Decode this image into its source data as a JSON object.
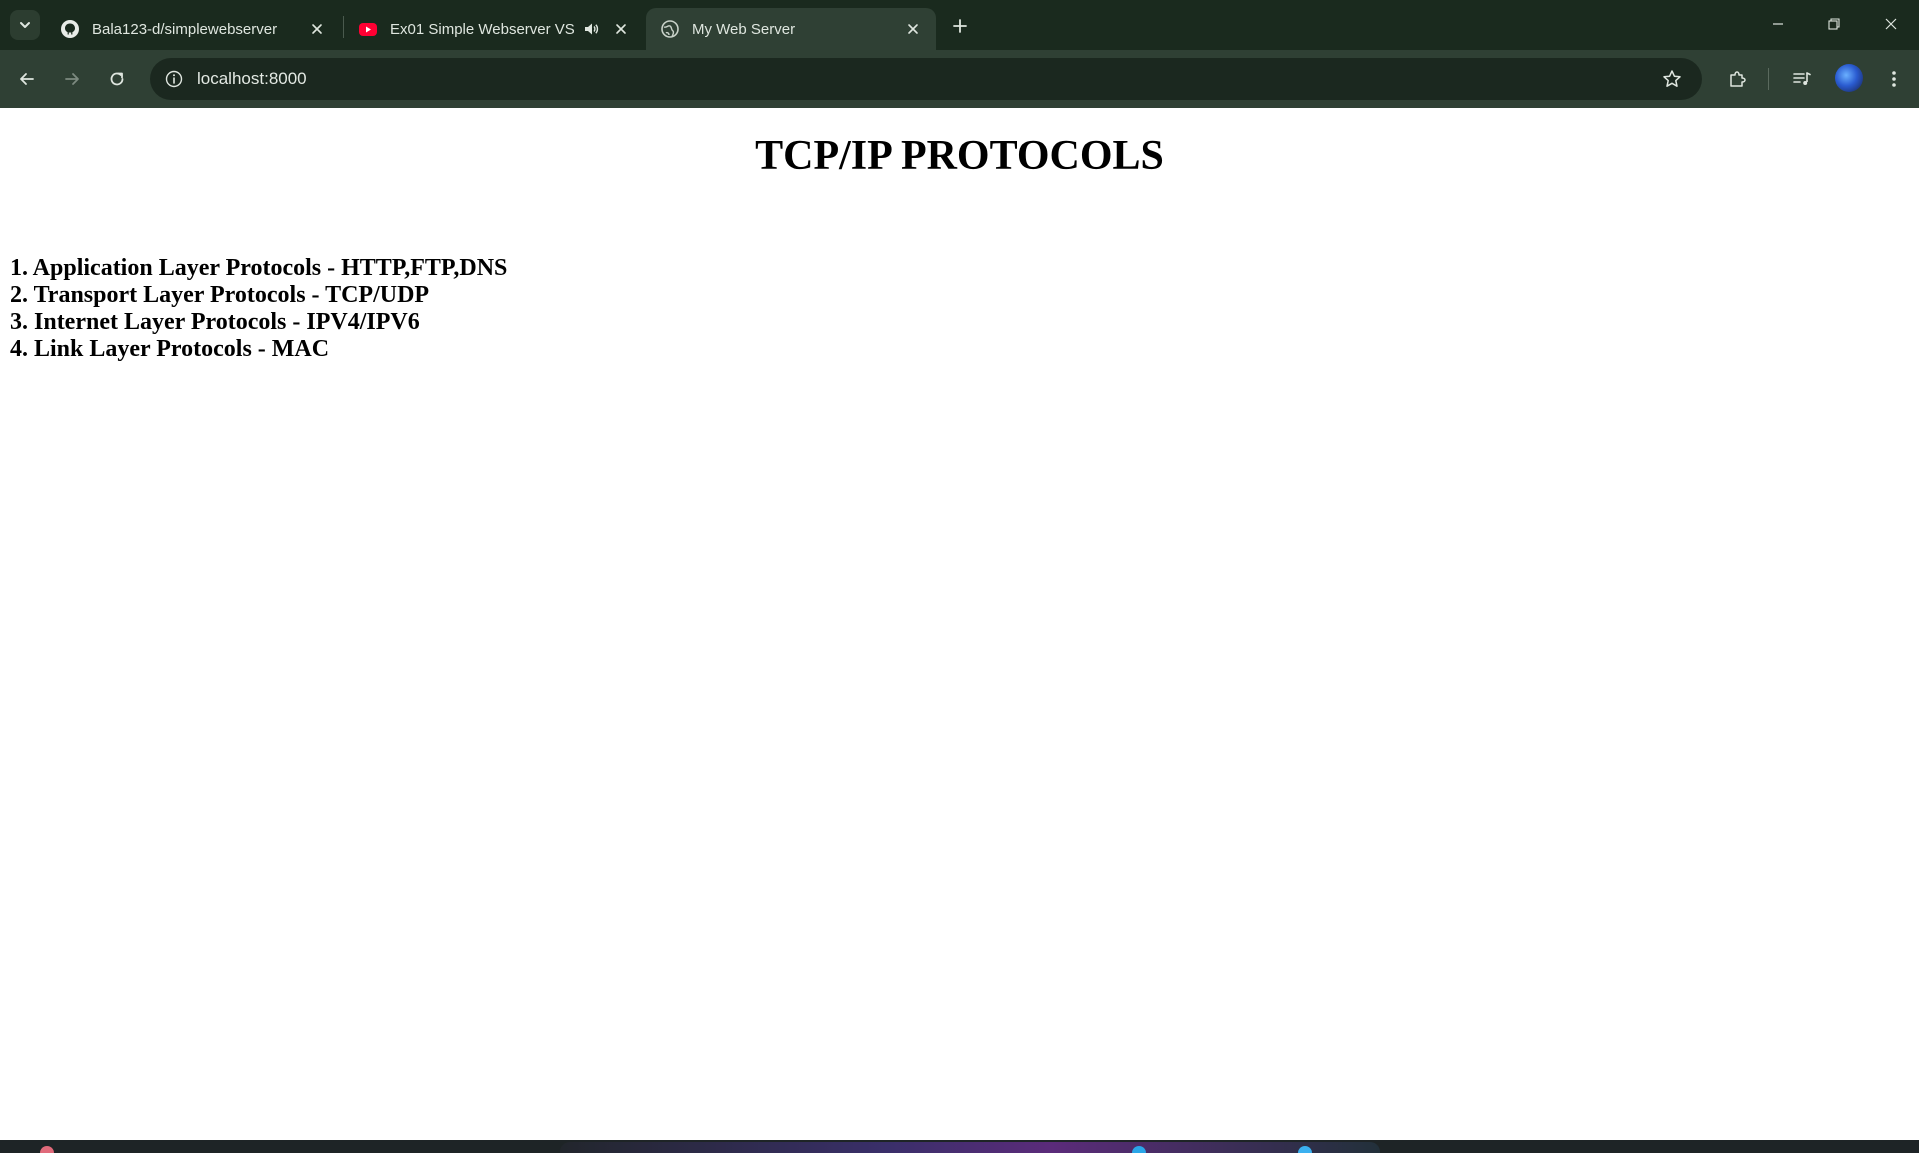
{
  "browser": {
    "tabs": [
      {
        "title": "Bala123-d/simplewebserver",
        "icon": "github-icon"
      },
      {
        "title": "Ex01 Simple Webserver VS (",
        "icon": "youtube-icon",
        "audio": true
      },
      {
        "title": "My Web Server",
        "icon": "globe-icon",
        "active": true
      }
    ],
    "address": {
      "url": "localhost:8000"
    }
  },
  "page": {
    "title": "TCP/IP PROTOCOLS",
    "protocols": [
      "1. Application Layer Protocols - HTTP,FTP,DNS",
      "2. Transport Layer Protocols - TCP/UDP",
      "3. Internet Layer Protocols - IPV4/IPV6",
      "4. Link Layer Protocols - MAC"
    ]
  },
  "colors": {
    "tabstrip": "#1a2a1e",
    "toolbar": "#2f4034",
    "omnibox": "#1b281f",
    "youtube_red": "#ff0033"
  }
}
